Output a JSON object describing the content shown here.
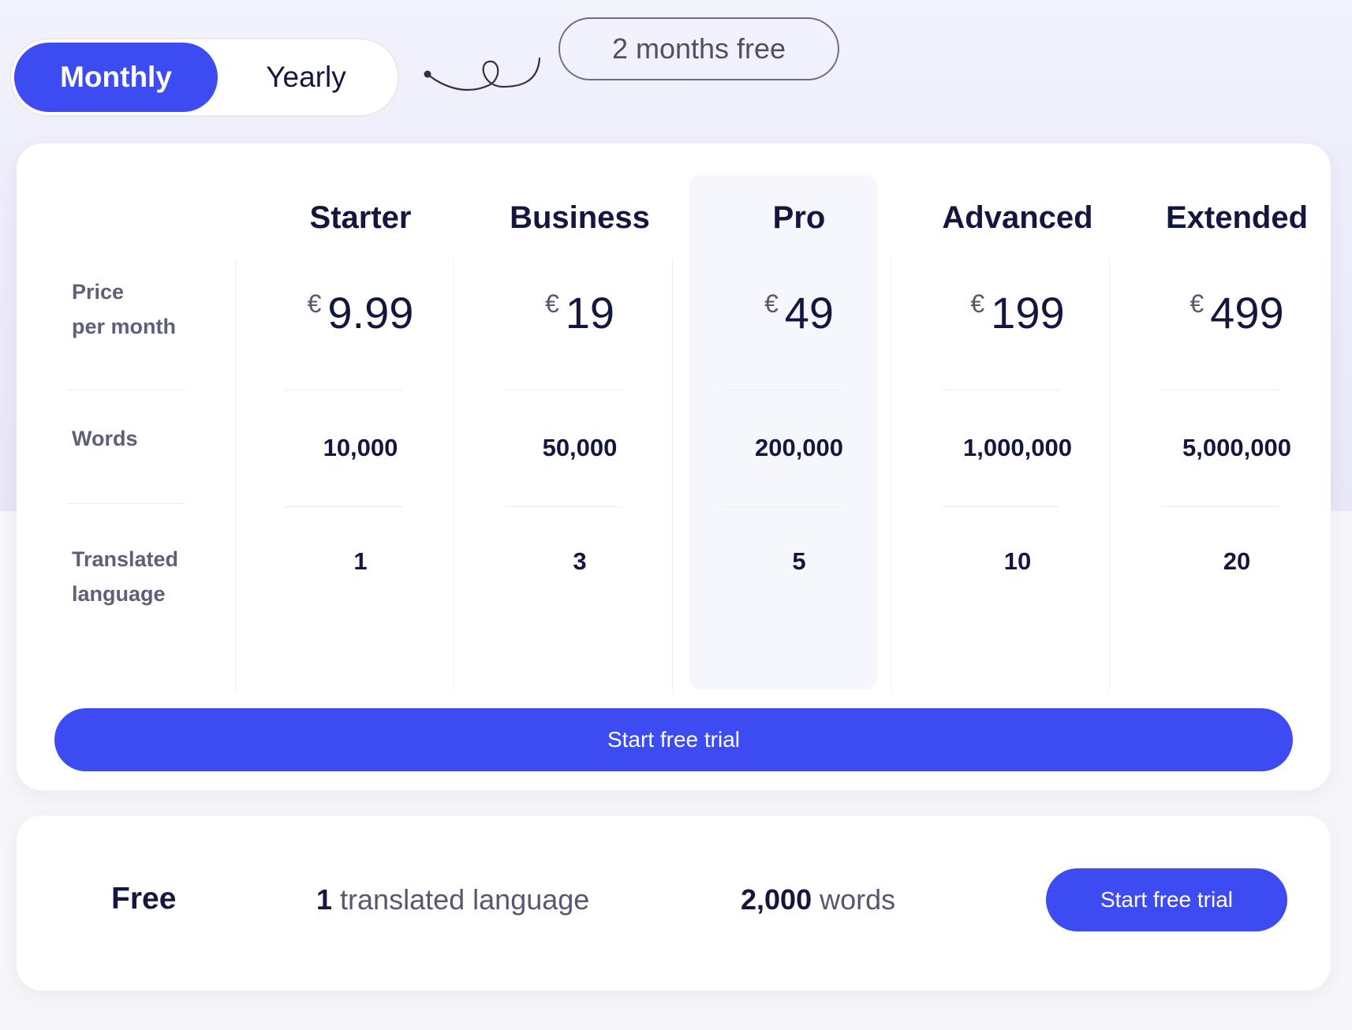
{
  "billing_toggle": {
    "options": [
      "Monthly",
      "Yearly"
    ],
    "selected": "Monthly"
  },
  "promo_badge": "2 months free",
  "pricing_table": {
    "row_labels": {
      "price": [
        "Price",
        "per month"
      ],
      "words": "Words",
      "languages": [
        "Translated",
        "language"
      ]
    },
    "currency": "€",
    "plans": [
      {
        "name": "Starter",
        "price": "9.99",
        "words": "10,000",
        "languages": "1"
      },
      {
        "name": "Business",
        "price": "19",
        "words": "50,000",
        "languages": "3"
      },
      {
        "name": "Pro",
        "price": "49",
        "words": "200,000",
        "languages": "5"
      },
      {
        "name": "Advanced",
        "price": "199",
        "words": "1,000,000",
        "languages": "10"
      },
      {
        "name": "Extended",
        "price": "499",
        "words": "5,000,000",
        "languages": "20"
      }
    ],
    "highlighted_plan": "Pro",
    "cta_label": "Start free trial"
  },
  "free_plan": {
    "name": "Free",
    "languages_value": "1",
    "languages_text": "translated language",
    "words_value": "2,000",
    "words_text": "words",
    "cta_label": "Start free trial"
  },
  "colors": {
    "accent": "#3c4cf2",
    "text_dark": "#13163f",
    "text_muted": "#5d6078",
    "highlight_column": "#f6f7fc"
  }
}
